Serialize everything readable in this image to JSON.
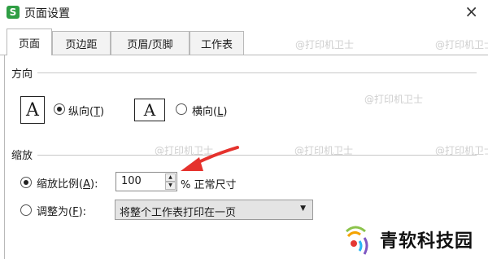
{
  "window": {
    "app_icon_letter": "S",
    "title": "页面设置",
    "close_glyph": "×"
  },
  "tabs": [
    {
      "label": "页面",
      "active": true
    },
    {
      "label": "页边距",
      "active": false
    },
    {
      "label": "页眉/页脚",
      "active": false
    },
    {
      "label": "工作表",
      "active": false
    }
  ],
  "orientation": {
    "heading": "方向",
    "portrait": {
      "glyph": "A",
      "label": "纵向",
      "key": "T",
      "selected": true
    },
    "landscape": {
      "glyph": "A",
      "label": "横向",
      "key": "L",
      "selected": false
    }
  },
  "scaling": {
    "heading": "缩放",
    "scale": {
      "label": "缩放比例",
      "key": "A",
      "selected": true,
      "value": "100",
      "suffix": "% 正常尺寸"
    },
    "fit": {
      "label": "调整为",
      "key": "F",
      "selected": false,
      "option": "将整个工作表打印在一页"
    }
  },
  "watermark": "@打印机卫士",
  "logo": {
    "text": "青软科技园"
  },
  "colors": {
    "arrow": "#e5322d",
    "app_icon": "#2f9e44"
  }
}
